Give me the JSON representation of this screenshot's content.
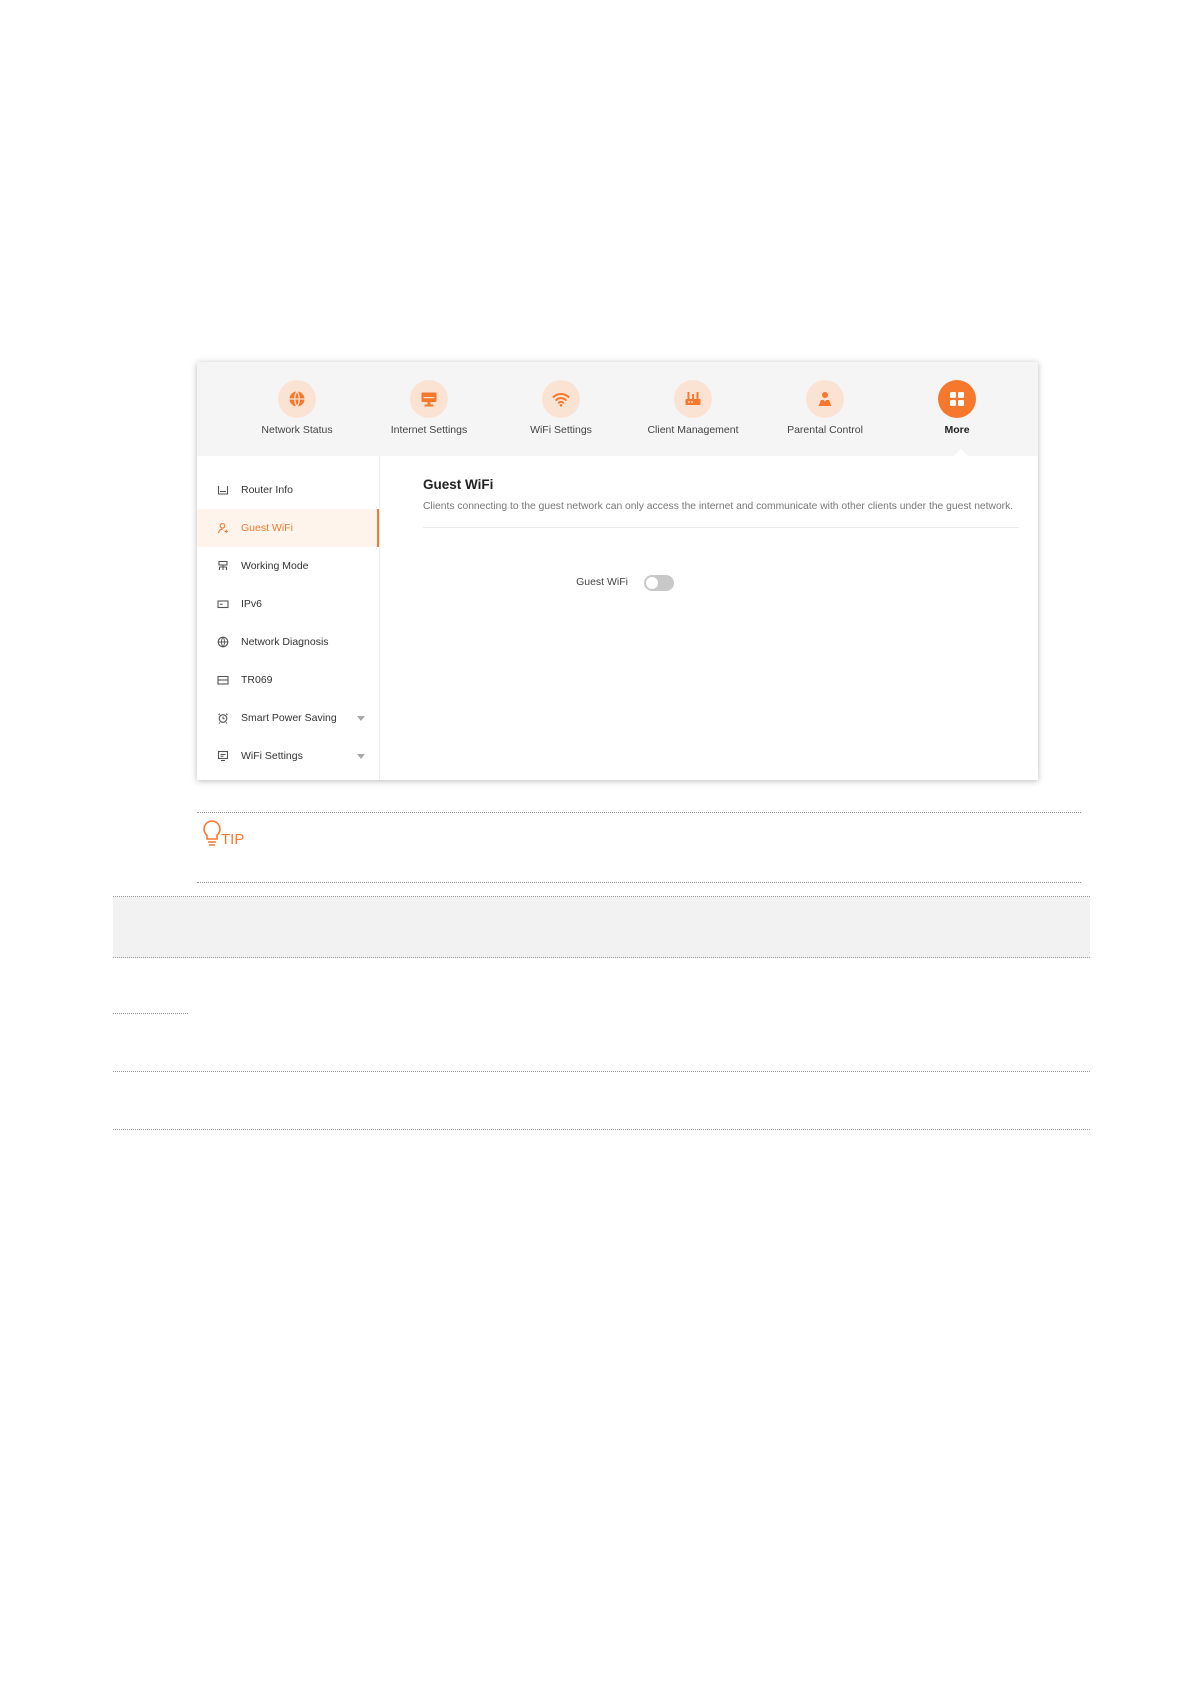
{
  "topnav": {
    "items": [
      {
        "label": "Network Status",
        "icon": "globe-icon"
      },
      {
        "label": "Internet Settings",
        "icon": "monitor-icon"
      },
      {
        "label": "WiFi Settings",
        "icon": "wifi-icon"
      },
      {
        "label": "Client Management",
        "icon": "router-icon"
      },
      {
        "label": "Parental Control",
        "icon": "parental-icon"
      },
      {
        "label": "More",
        "icon": "grid-icon"
      }
    ],
    "active": "More"
  },
  "sidebar": {
    "items": [
      {
        "label": "Router Info",
        "icon": "router-info-icon"
      },
      {
        "label": "Guest WiFi",
        "icon": "guest-user-icon"
      },
      {
        "label": "Working Mode",
        "icon": "working-mode-icon"
      },
      {
        "label": "IPv6",
        "icon": "ipv6-icon"
      },
      {
        "label": "Network Diagnosis",
        "icon": "globe-icon"
      },
      {
        "label": "TR069",
        "icon": "tr069-icon"
      },
      {
        "label": "Smart Power Saving",
        "icon": "alarm-clock-icon"
      },
      {
        "label": "WiFi Settings",
        "icon": "wifi-settings-icon"
      }
    ],
    "active": "Guest WiFi"
  },
  "content": {
    "title": "Guest WiFi",
    "description": "Clients connecting to the guest network can only access the internet and communicate with other clients under the guest network.",
    "guest_wifi_label": "Guest WiFi",
    "guest_wifi_enabled": false
  },
  "tip": {
    "label": "TIP"
  },
  "colors": {
    "accent": "#f5782d",
    "accent_light": "#fbe3d3",
    "nav_bg": "#f5f5f5",
    "toggle_off": "#c8c8c8"
  }
}
